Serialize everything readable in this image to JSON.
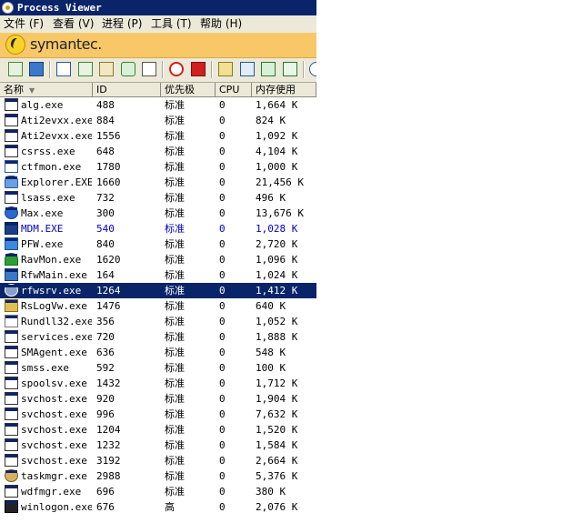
{
  "window": {
    "title": "Process Viewer"
  },
  "menu": [
    "文件 (F)",
    "查看 (V)",
    "进程 (P)",
    "工具 (T)",
    "帮助 (H)"
  ],
  "brand": {
    "name": "symantec."
  },
  "columns": {
    "name": "名称",
    "id": "ID",
    "priority": "优先极",
    "cpu": "CPU",
    "memory": "内存使用"
  },
  "processes": [
    {
      "name": "alg.exe",
      "id": "488",
      "priority": "标准",
      "cpu": "0",
      "memory": "1,664 K"
    },
    {
      "name": "Ati2evxx.exe",
      "id": "884",
      "priority": "标准",
      "cpu": "0",
      "memory": "824 K"
    },
    {
      "name": "Ati2evxx.exe",
      "id": "1556",
      "priority": "标准",
      "cpu": "0",
      "memory": "1,092 K"
    },
    {
      "name": "csrss.exe",
      "id": "648",
      "priority": "标准",
      "cpu": "0",
      "memory": "4,104 K"
    },
    {
      "name": "ctfmon.exe",
      "id": "1780",
      "priority": "标准",
      "cpu": "0",
      "memory": "1,000 K"
    },
    {
      "name": "Explorer.EXE",
      "id": "1660",
      "priority": "标准",
      "cpu": "0",
      "memory": "21,456 K"
    },
    {
      "name": "lsass.exe",
      "id": "732",
      "priority": "标准",
      "cpu": "0",
      "memory": "496 K"
    },
    {
      "name": "Max.exe",
      "id": "300",
      "priority": "标准",
      "cpu": "0",
      "memory": "13,676 K"
    },
    {
      "name": "MDM.EXE",
      "id": "540",
      "priority": "标准",
      "cpu": "0",
      "memory": "1,028 K"
    },
    {
      "name": "PFW.exe",
      "id": "840",
      "priority": "标准",
      "cpu": "0",
      "memory": "2,720 K"
    },
    {
      "name": "RavMon.exe",
      "id": "1620",
      "priority": "标准",
      "cpu": "0",
      "memory": "1,096 K"
    },
    {
      "name": "RfwMain.exe",
      "id": "164",
      "priority": "标准",
      "cpu": "0",
      "memory": "1,024 K"
    },
    {
      "name": "rfwsrv.exe",
      "id": "1264",
      "priority": "标准",
      "cpu": "0",
      "memory": "1,412 K"
    },
    {
      "name": "RsLogVw.exe",
      "id": "1476",
      "priority": "标准",
      "cpu": "0",
      "memory": "640 K"
    },
    {
      "name": "Rundll32.exe",
      "id": "356",
      "priority": "标准",
      "cpu": "0",
      "memory": "1,052 K"
    },
    {
      "name": "services.exe",
      "id": "720",
      "priority": "标准",
      "cpu": "0",
      "memory": "1,888 K"
    },
    {
      "name": "SMAgent.exe",
      "id": "636",
      "priority": "标准",
      "cpu": "0",
      "memory": "548 K"
    },
    {
      "name": "smss.exe",
      "id": "592",
      "priority": "标准",
      "cpu": "0",
      "memory": "100 K"
    },
    {
      "name": "spoolsv.exe",
      "id": "1432",
      "priority": "标准",
      "cpu": "0",
      "memory": "1,712 K"
    },
    {
      "name": "svchost.exe",
      "id": "920",
      "priority": "标准",
      "cpu": "0",
      "memory": "1,904 K"
    },
    {
      "name": "svchost.exe",
      "id": "996",
      "priority": "标准",
      "cpu": "0",
      "memory": "7,632 K"
    },
    {
      "name": "svchost.exe",
      "id": "1204",
      "priority": "标准",
      "cpu": "0",
      "memory": "1,520 K"
    },
    {
      "name": "svchost.exe",
      "id": "1232",
      "priority": "标准",
      "cpu": "0",
      "memory": "1,584 K"
    },
    {
      "name": "svchost.exe",
      "id": "3192",
      "priority": "标准",
      "cpu": "0",
      "memory": "2,664 K"
    },
    {
      "name": "taskmgr.exe",
      "id": "2988",
      "priority": "标准",
      "cpu": "0",
      "memory": "5,376 K"
    },
    {
      "name": "wdfmgr.exe",
      "id": "696",
      "priority": "标准",
      "cpu": "0",
      "memory": "380 K"
    },
    {
      "name": "winlogon.exe",
      "id": "676",
      "priority": "高",
      "cpu": "0",
      "memory": "2,076 K"
    }
  ],
  "selected_process": "rfwsrv.exe",
  "highlighted_process": "MDM.EXE",
  "colors": {
    "titlebar": "#0a246a",
    "brand_band": "#f8c868",
    "selection": "#0a246a",
    "highlight_text": "#0000c0"
  }
}
